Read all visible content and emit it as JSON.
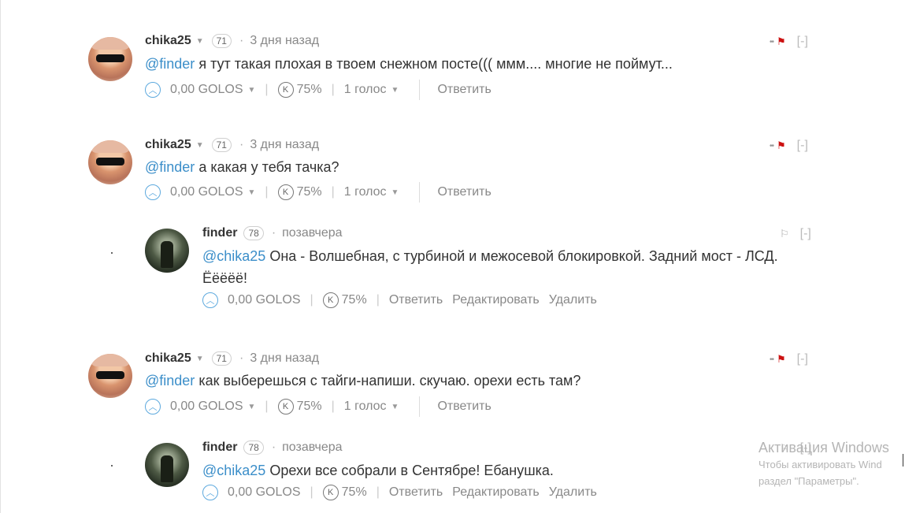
{
  "comments": [
    {
      "author": "chika25",
      "rep": "71",
      "time": "3 дня назад",
      "mention": "@finder",
      "text": "я тут такая плохая в твоем снежном посте((( ммм.... многие не поймут...",
      "payout": "0,00 GOLOS",
      "percent": "75%",
      "votes": "1 голос",
      "reply": "Ответить",
      "toggle": "[-]"
    },
    {
      "author": "chika25",
      "rep": "71",
      "time": "3 дня назад",
      "mention": "@finder",
      "text": "а какая у тебя тачка?",
      "payout": "0,00 GOLOS",
      "percent": "75%",
      "votes": "1 голос",
      "reply": "Ответить",
      "toggle": "[-]"
    },
    {
      "author": "finder",
      "rep": "78",
      "time": "позавчера",
      "mention": "@chika25",
      "text": "Она - Волшебная, с турбиной и межосевой блокировкой. Задний мост - ЛСД.",
      "text2": "Ёёёёё!",
      "payout": "0,00 GOLOS",
      "percent": "75%",
      "reply": "Ответить",
      "edit": "Редактировать",
      "delete": "Удалить",
      "toggle": "[-]"
    },
    {
      "author": "chika25",
      "rep": "71",
      "time": "3 дня назад",
      "mention": "@finder",
      "text": "как выберешься с тайги-напиши. скучаю. орехи есть там?",
      "payout": "0,00 GOLOS",
      "percent": "75%",
      "votes": "1 голос",
      "reply": "Ответить",
      "toggle": "[-]"
    },
    {
      "author": "finder",
      "rep": "78",
      "time": "позавчера",
      "mention": "@chika25",
      "text": "Орехи все собрали в Сентябре! Ебанушка.",
      "payout": "0,00 GOLOS",
      "percent": "75%",
      "reply": "Ответить",
      "edit": "Редактировать",
      "delete": "Удалить",
      "toggle": "[-]"
    }
  ],
  "icons": {
    "upvote": "chevron-up-icon",
    "curation": "k-badge-icon",
    "flag": "flag-icon",
    "menu": "more-icon",
    "dropdown": "caret-down-icon"
  },
  "colors": {
    "mention": "#3b8ec9",
    "flag": "#cc1111",
    "upvote": "#5da9de"
  },
  "watermark": {
    "title": "Активация Windows",
    "line1": "Чтобы активировать Wind",
    "line2": "раздел \"Параметры\"."
  }
}
